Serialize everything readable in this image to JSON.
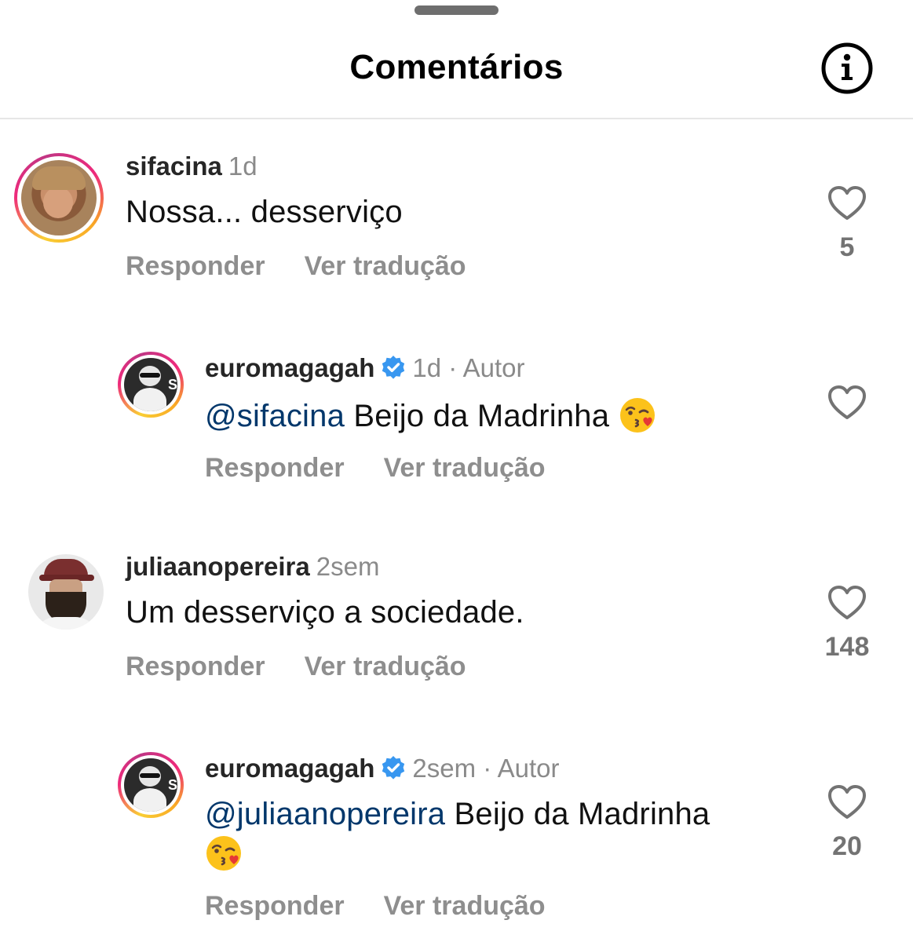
{
  "header": {
    "title": "Comentários",
    "info_icon": "info-circle-icon"
  },
  "colors": {
    "mention": "#00376b",
    "secondary_text": "#8e8e8e",
    "verified": "#3897f0"
  },
  "comments": [
    {
      "username": "sifacina",
      "time": "1d",
      "text": "Nossa... desserviço",
      "reply_label": "Responder",
      "translate_label": "Ver tradução",
      "likes": "5",
      "story_ring": true
    },
    {
      "username": "euromagagah",
      "verified": true,
      "time": "1d",
      "author_label": "· Autor",
      "mention": "@sifacina",
      "text": "Beijo da Madrinha",
      "emoji": "kissing-face-with-heart-emoji",
      "reply_label": "Responder",
      "translate_label": "Ver tradução",
      "likes": "",
      "story_ring": true
    },
    {
      "username": "juliaanopereira",
      "time": "2sem",
      "text": "Um desserviço a sociedade.",
      "reply_label": "Responder",
      "translate_label": "Ver tradução",
      "likes": "148",
      "story_ring": false
    },
    {
      "username": "euromagagah",
      "verified": true,
      "time": "2sem",
      "author_label": "· Autor",
      "mention": "@juliaanopereira",
      "text": "Beijo da Madrinha",
      "emoji": "kissing-face-with-heart-emoji",
      "reply_label": "Responder",
      "translate_label": "Ver tradução",
      "likes": "20",
      "story_ring": true
    }
  ]
}
